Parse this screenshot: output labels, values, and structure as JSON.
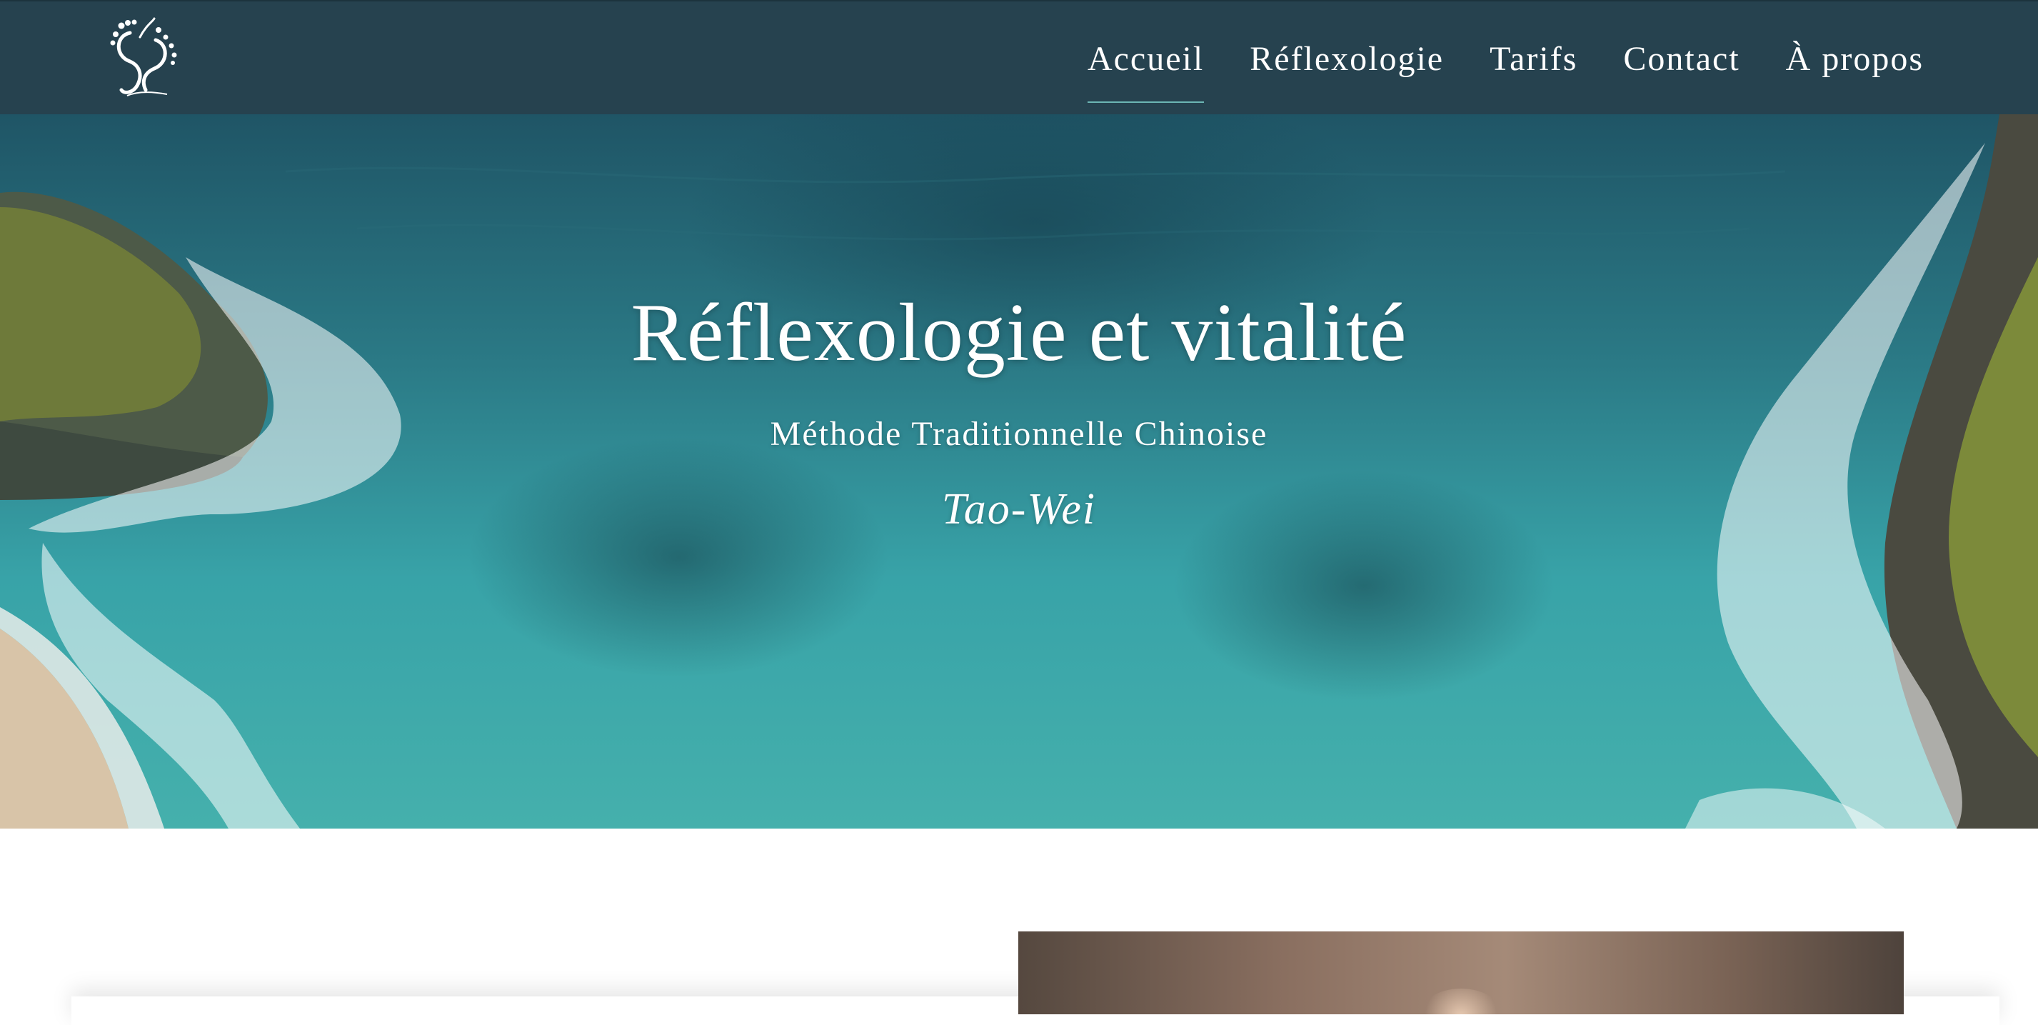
{
  "nav": {
    "items": [
      {
        "label": "Accueil",
        "active": true
      },
      {
        "label": "Réflexologie",
        "active": false
      },
      {
        "label": "Tarifs",
        "active": false
      },
      {
        "label": "Contact",
        "active": false
      },
      {
        "label": "À propos",
        "active": false
      }
    ]
  },
  "logo": {
    "icon": "feet-heart-logo"
  },
  "hero": {
    "title": "Réflexologie et vitalité",
    "subtitle": "Méthode Traditionnelle Chinoise",
    "author": "Tao-Wei"
  },
  "colors": {
    "navbar": "#26424f",
    "nav_active_underline": "#6cb6b4",
    "text": "#ffffff"
  }
}
